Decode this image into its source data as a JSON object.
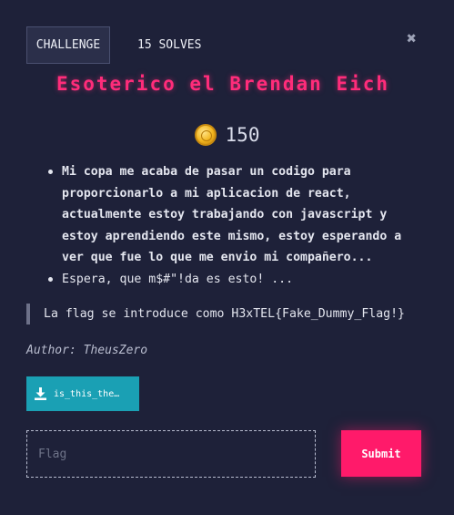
{
  "tabs": {
    "challenge": "CHALLENGE",
    "solves": "15 SOLVES"
  },
  "close_symbol": "✖",
  "challenge": {
    "title": "Esoterico el Brendan Eich",
    "points": "150",
    "description": [
      "Mi copa me acaba de pasar un codigo para proporcionarlo a mi aplicacion de react, actualmente estoy trabajando con javascript y estoy aprendiendo este mismo, estoy esperando a ver que fue lo que me envio mi compañero...",
      "Espera, que m$#\"!da es esto! ..."
    ],
    "quote": "La flag se introduce como H3xTEL{Fake_Dummy_Flag!}",
    "author": "Author: TheusZero"
  },
  "file": {
    "name": "is_this_the…",
    "icon": "download-icon"
  },
  "form": {
    "flag_placeholder": "Flag",
    "flag_value": "",
    "submit_label": "Submit"
  },
  "colors": {
    "background": "#1e2139",
    "title": "#ff2c7a",
    "submit": "#ff1a6a",
    "download": "#1aa0b4",
    "coin": "#f2b51e"
  }
}
